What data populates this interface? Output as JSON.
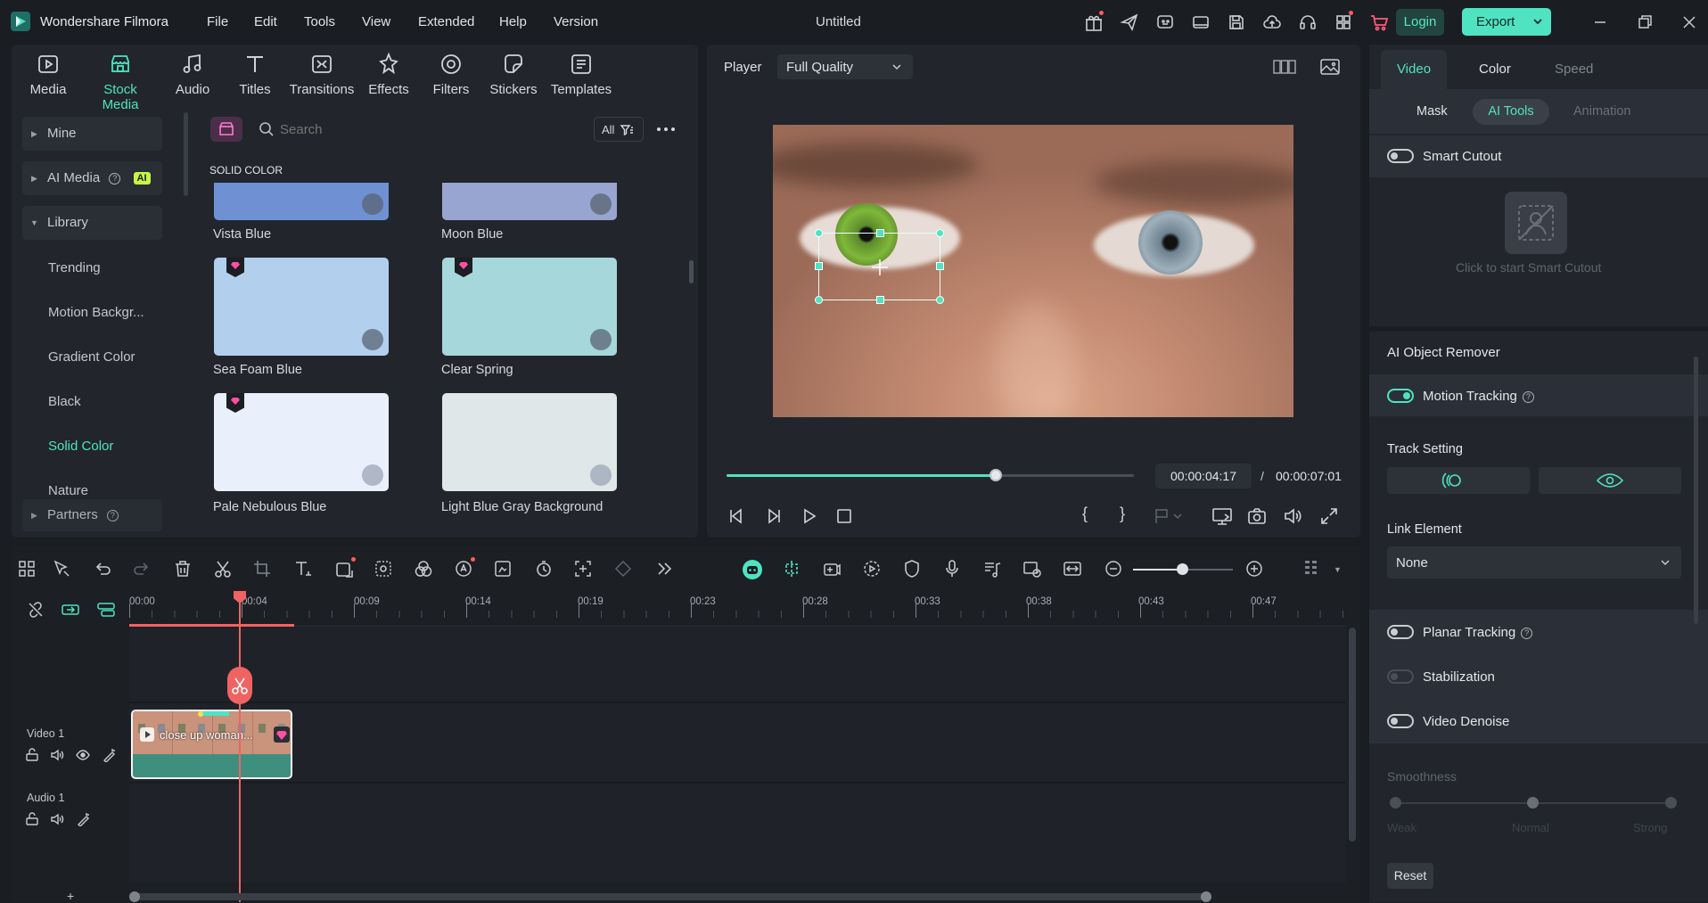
{
  "app": {
    "name": "Wondershare Filmora",
    "title": "Untitled",
    "menu": [
      "File",
      "Edit",
      "Tools",
      "View",
      "Extended",
      "Help",
      "Version"
    ],
    "login": "Login",
    "export": "Export"
  },
  "media_tabs": [
    {
      "label": "Media",
      "icon": "media-icon"
    },
    {
      "label": "Stock Media",
      "icon": "stock-media-icon",
      "active": true
    },
    {
      "label": "Audio",
      "icon": "audio-icon"
    },
    {
      "label": "Titles",
      "icon": "titles-icon"
    },
    {
      "label": "Transitions",
      "icon": "transitions-icon"
    },
    {
      "label": "Effects",
      "icon": "effects-icon"
    },
    {
      "label": "Filters",
      "icon": "filters-icon"
    },
    {
      "label": "Stickers",
      "icon": "stickers-icon"
    },
    {
      "label": "Templates",
      "icon": "templates-icon"
    }
  ],
  "sidebar": {
    "mine": "Mine",
    "ai_media": "AI Media",
    "ai_badge": "AI",
    "library": "Library",
    "items": [
      "Trending",
      "Motion Backgr...",
      "Gradient Color",
      "Black",
      "Solid Color",
      "Nature"
    ],
    "partners": "Partners"
  },
  "library": {
    "search_placeholder": "Search",
    "filter_label": "All",
    "section": "SOLID COLOR",
    "swatches": [
      {
        "name": "Vista Blue",
        "color": "#6f91d3"
      },
      {
        "name": "Moon Blue",
        "color": "#98a5d0"
      },
      {
        "name": "Sea Foam Blue",
        "color": "#b2d0ee"
      },
      {
        "name": "Clear Spring",
        "color": "#a6d7db"
      },
      {
        "name": "Pale Nebulous Blue",
        "color": "#e9f0fb"
      },
      {
        "name": "Light Blue Gray Background",
        "color": "#dfe7e9"
      }
    ]
  },
  "player": {
    "label": "Player",
    "quality": "Full Quality",
    "current_time": "00:00:04:17",
    "separator": "/",
    "total_time": "00:00:07:01",
    "progress": 0.66
  },
  "timeline": {
    "ruler": [
      "00:00",
      "00:04",
      "00:09",
      "00:14",
      "00:19",
      "00:23",
      "00:28",
      "00:33",
      "00:38",
      "00:43",
      "00:47"
    ],
    "video_track": "Video 1",
    "audio_track": "Audio 1",
    "clip_title": "close up woman...",
    "add_symbol": "+"
  },
  "right_panel": {
    "tabs": [
      "Video",
      "Color",
      "Speed"
    ],
    "subtabs": [
      "Mask",
      "AI Tools",
      "Animation"
    ],
    "smart_cutout": "Smart Cutout",
    "smart_cutout_hint": "Click to start Smart Cutout",
    "ai_object_remover": "AI Object Remover",
    "motion_tracking": "Motion Tracking",
    "track_setting": "Track Setting",
    "link_element": "Link Element",
    "link_value": "None",
    "planar_tracking": "Planar Tracking",
    "stabilization": "Stabilization",
    "video_denoise": "Video Denoise",
    "smoothness": "Smoothness",
    "smoothness_levels": [
      "Weak",
      "Normal",
      "Strong"
    ],
    "reset": "Reset"
  },
  "colors": {
    "accent": "#4fe3c1",
    "playhead": "#f06363",
    "bg": "#1a1d22",
    "panel": "#22262c"
  }
}
